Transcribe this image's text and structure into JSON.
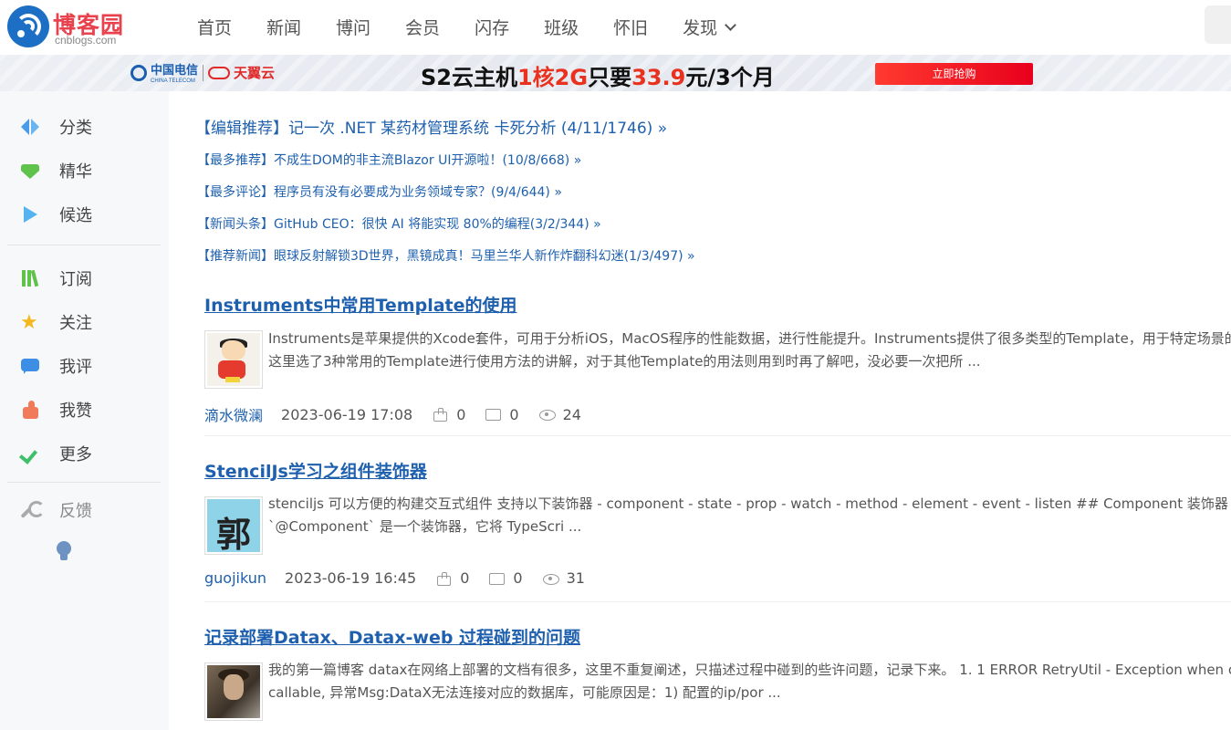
{
  "header": {
    "logo_title": "博客园",
    "logo_sub": "cnblogs.com",
    "nav": [
      "首页",
      "新闻",
      "博问",
      "会员",
      "闪存",
      "班级",
      "怀旧",
      "发现"
    ]
  },
  "banner": {
    "ct_name": "中国电信",
    "ct_en": "CHINA TELECOM",
    "ty_name": "天翼云",
    "promo_a": "S2云主机",
    "promo_b": "1核2G",
    "promo_c": "只要",
    "promo_d": "33.9",
    "promo_e": "元/3个月",
    "buy": "立即抢购"
  },
  "sidebar": {
    "items": [
      {
        "label": "分类",
        "icon": "category-icon"
      },
      {
        "label": "精华",
        "icon": "gem-icon"
      },
      {
        "label": "候选",
        "icon": "play-icon"
      },
      {
        "label": "订阅",
        "icon": "books-icon"
      },
      {
        "label": "关注",
        "icon": "star-icon"
      },
      {
        "label": "我评",
        "icon": "chat-icon"
      },
      {
        "label": "我赞",
        "icon": "thumb-icon"
      },
      {
        "label": "更多",
        "icon": "chevron-down-icon"
      },
      {
        "label": "反馈",
        "icon": "wrench-icon"
      }
    ]
  },
  "recommend": [
    {
      "tag": "【编辑推荐】",
      "text": "记一次 .NET 某药材管理系统 卡死分析 (4/11/1746) »"
    },
    {
      "tag": "【最多推荐】",
      "text": "不成生DOM的非主流Blazor UI开源啦！(10/8/668) »"
    },
    {
      "tag": "【最多评论】",
      "text": "程序员有没有必要成为业务领域专家？(9/4/644) »"
    },
    {
      "tag": "【新闻头条】",
      "text": "GitHub CEO：很快 AI 将能实现 80%的编程(3/2/344) »"
    },
    {
      "tag": "【推荐新闻】",
      "text": "眼球反射解锁3D世界，黑镜成真！马里兰华人新作炸翻科幻迷(1/3/497) »"
    }
  ],
  "posts": [
    {
      "title": "Instruments中常用Template的使用",
      "summary1": "Instruments是苹果提供的Xcode套件，可用于分析iOS，MacOS程序的性能数据，进行性能提升。Instruments提供了很多类型的Template，用于特定场景的分",
      "summary2": "这里选了3种常用的Template进行使用方法的讲解，对于其他Template的用法则用到时再了解吧，没必要一次把所 ...",
      "author": "滴水微澜",
      "date": "2023-06-19 17:08",
      "likes": "0",
      "comments": "0",
      "views": "24"
    },
    {
      "title": "StencilJs学习之组件装饰器",
      "summary1": "stenciljs 可以方便的构建交互式组件 支持以下装饰器 - component - state - prop - watch - method - element - event - listen ## Component 装饰器",
      "summary2": "`@Component` 是一个装饰器，它将 TypeScri ...",
      "author": "guojikun",
      "date": "2023-06-19 16:45",
      "likes": "0",
      "comments": "0",
      "views": "31",
      "avatar_char": "郭"
    },
    {
      "title": "记录部署Datax、Datax-web 过程碰到的问题",
      "summary1": "我的第一篇博客 datax在网络上部署的文档有很多，这里不重复阐述，只描述过程中碰到的些许问题，记录下来。 1. 1 ERROR RetryUtil - Exception when calling",
      "summary2": "callable, 异常Msg:DataX无法连接对应的数据库，可能原因是：1) 配置的ip/por ..."
    }
  ]
}
